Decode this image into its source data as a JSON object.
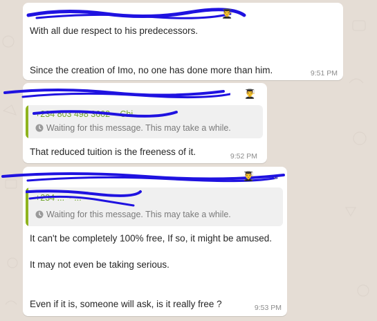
{
  "messages": [
    {
      "sender_emoji": "👨‍🎓",
      "lines": [
        "With all due respect to his predecessors.",
        "Since the creation of Imo, no one has done more than him."
      ],
      "time": "9:51 PM"
    },
    {
      "sender_emoji": "👨‍🎓",
      "quote": {
        "name": "+234 803 498 3602 ~ Chi...",
        "waiting": "Waiting for this message. This may take a while."
      },
      "lines": [
        "That reduced tuition is the freeness of it."
      ],
      "time": "9:52 PM"
    },
    {
      "sender_emoji": "👨‍🎓",
      "quote": {
        "name": "+234 ... ~ ...",
        "waiting": "Waiting for this message. This may take a while."
      },
      "lines": [
        "It can't be completely 100% free, If so, it might be amused.",
        "It may not even be taking serious.",
        "Even if it is, someone will ask, is it really free ?"
      ],
      "time": "9:53 PM"
    }
  ],
  "colors": {
    "bubble": "#ffffff",
    "background": "#e5ddd5",
    "quote_bar": "#90b41e",
    "quote_name": "#6fa42a"
  },
  "icons": {
    "clock": "clock-icon",
    "menu": "chevron-down-icon"
  }
}
